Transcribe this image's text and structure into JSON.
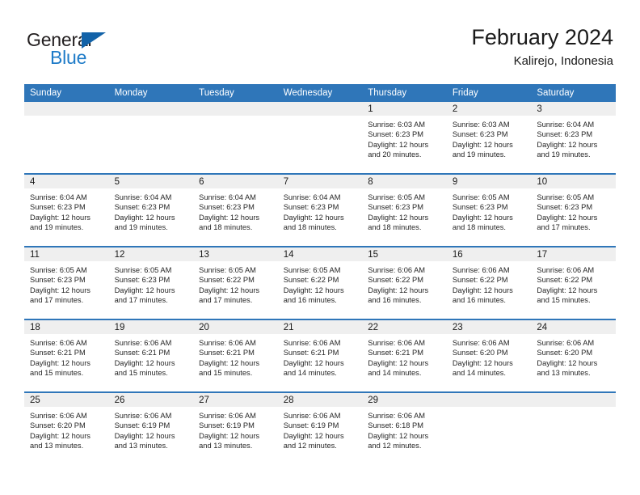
{
  "brand": {
    "line1": "General",
    "line2": "Blue",
    "triangle_color": "#1262a8",
    "line2_color": "#1e7bc8"
  },
  "header": {
    "title": "February 2024",
    "subtitle": "Kalirejo, Indonesia"
  },
  "theme": {
    "header_blue": "#2f76b9",
    "row_band_gray": "#efefef",
    "text_color": "#262626"
  },
  "calendar": {
    "weekday_headers": [
      "Sunday",
      "Monday",
      "Tuesday",
      "Wednesday",
      "Thursday",
      "Friday",
      "Saturday"
    ],
    "weeks": [
      [
        {
          "day": "",
          "lines": []
        },
        {
          "day": "",
          "lines": []
        },
        {
          "day": "",
          "lines": []
        },
        {
          "day": "",
          "lines": []
        },
        {
          "day": "1",
          "lines": [
            "Sunrise: 6:03 AM",
            "Sunset: 6:23 PM",
            "Daylight: 12 hours",
            "and 20 minutes."
          ]
        },
        {
          "day": "2",
          "lines": [
            "Sunrise: 6:03 AM",
            "Sunset: 6:23 PM",
            "Daylight: 12 hours",
            "and 19 minutes."
          ]
        },
        {
          "day": "3",
          "lines": [
            "Sunrise: 6:04 AM",
            "Sunset: 6:23 PM",
            "Daylight: 12 hours",
            "and 19 minutes."
          ]
        }
      ],
      [
        {
          "day": "4",
          "lines": [
            "Sunrise: 6:04 AM",
            "Sunset: 6:23 PM",
            "Daylight: 12 hours",
            "and 19 minutes."
          ]
        },
        {
          "day": "5",
          "lines": [
            "Sunrise: 6:04 AM",
            "Sunset: 6:23 PM",
            "Daylight: 12 hours",
            "and 19 minutes."
          ]
        },
        {
          "day": "6",
          "lines": [
            "Sunrise: 6:04 AM",
            "Sunset: 6:23 PM",
            "Daylight: 12 hours",
            "and 18 minutes."
          ]
        },
        {
          "day": "7",
          "lines": [
            "Sunrise: 6:04 AM",
            "Sunset: 6:23 PM",
            "Daylight: 12 hours",
            "and 18 minutes."
          ]
        },
        {
          "day": "8",
          "lines": [
            "Sunrise: 6:05 AM",
            "Sunset: 6:23 PM",
            "Daylight: 12 hours",
            "and 18 minutes."
          ]
        },
        {
          "day": "9",
          "lines": [
            "Sunrise: 6:05 AM",
            "Sunset: 6:23 PM",
            "Daylight: 12 hours",
            "and 18 minutes."
          ]
        },
        {
          "day": "10",
          "lines": [
            "Sunrise: 6:05 AM",
            "Sunset: 6:23 PM",
            "Daylight: 12 hours",
            "and 17 minutes."
          ]
        }
      ],
      [
        {
          "day": "11",
          "lines": [
            "Sunrise: 6:05 AM",
            "Sunset: 6:23 PM",
            "Daylight: 12 hours",
            "and 17 minutes."
          ]
        },
        {
          "day": "12",
          "lines": [
            "Sunrise: 6:05 AM",
            "Sunset: 6:23 PM",
            "Daylight: 12 hours",
            "and 17 minutes."
          ]
        },
        {
          "day": "13",
          "lines": [
            "Sunrise: 6:05 AM",
            "Sunset: 6:22 PM",
            "Daylight: 12 hours",
            "and 17 minutes."
          ]
        },
        {
          "day": "14",
          "lines": [
            "Sunrise: 6:05 AM",
            "Sunset: 6:22 PM",
            "Daylight: 12 hours",
            "and 16 minutes."
          ]
        },
        {
          "day": "15",
          "lines": [
            "Sunrise: 6:06 AM",
            "Sunset: 6:22 PM",
            "Daylight: 12 hours",
            "and 16 minutes."
          ]
        },
        {
          "day": "16",
          "lines": [
            "Sunrise: 6:06 AM",
            "Sunset: 6:22 PM",
            "Daylight: 12 hours",
            "and 16 minutes."
          ]
        },
        {
          "day": "17",
          "lines": [
            "Sunrise: 6:06 AM",
            "Sunset: 6:22 PM",
            "Daylight: 12 hours",
            "and 15 minutes."
          ]
        }
      ],
      [
        {
          "day": "18",
          "lines": [
            "Sunrise: 6:06 AM",
            "Sunset: 6:21 PM",
            "Daylight: 12 hours",
            "and 15 minutes."
          ]
        },
        {
          "day": "19",
          "lines": [
            "Sunrise: 6:06 AM",
            "Sunset: 6:21 PM",
            "Daylight: 12 hours",
            "and 15 minutes."
          ]
        },
        {
          "day": "20",
          "lines": [
            "Sunrise: 6:06 AM",
            "Sunset: 6:21 PM",
            "Daylight: 12 hours",
            "and 15 minutes."
          ]
        },
        {
          "day": "21",
          "lines": [
            "Sunrise: 6:06 AM",
            "Sunset: 6:21 PM",
            "Daylight: 12 hours",
            "and 14 minutes."
          ]
        },
        {
          "day": "22",
          "lines": [
            "Sunrise: 6:06 AM",
            "Sunset: 6:21 PM",
            "Daylight: 12 hours",
            "and 14 minutes."
          ]
        },
        {
          "day": "23",
          "lines": [
            "Sunrise: 6:06 AM",
            "Sunset: 6:20 PM",
            "Daylight: 12 hours",
            "and 14 minutes."
          ]
        },
        {
          "day": "24",
          "lines": [
            "Sunrise: 6:06 AM",
            "Sunset: 6:20 PM",
            "Daylight: 12 hours",
            "and 13 minutes."
          ]
        }
      ],
      [
        {
          "day": "25",
          "lines": [
            "Sunrise: 6:06 AM",
            "Sunset: 6:20 PM",
            "Daylight: 12 hours",
            "and 13 minutes."
          ]
        },
        {
          "day": "26",
          "lines": [
            "Sunrise: 6:06 AM",
            "Sunset: 6:19 PM",
            "Daylight: 12 hours",
            "and 13 minutes."
          ]
        },
        {
          "day": "27",
          "lines": [
            "Sunrise: 6:06 AM",
            "Sunset: 6:19 PM",
            "Daylight: 12 hours",
            "and 13 minutes."
          ]
        },
        {
          "day": "28",
          "lines": [
            "Sunrise: 6:06 AM",
            "Sunset: 6:19 PM",
            "Daylight: 12 hours",
            "and 12 minutes."
          ]
        },
        {
          "day": "29",
          "lines": [
            "Sunrise: 6:06 AM",
            "Sunset: 6:18 PM",
            "Daylight: 12 hours",
            "and 12 minutes."
          ]
        },
        {
          "day": "",
          "lines": []
        },
        {
          "day": "",
          "lines": []
        }
      ]
    ]
  }
}
